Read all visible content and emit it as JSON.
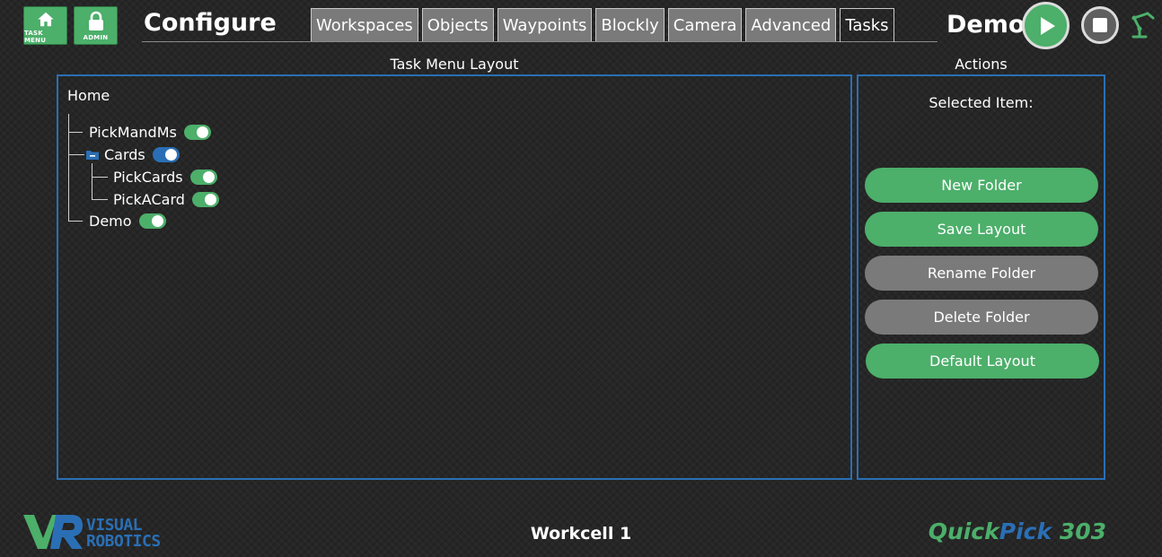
{
  "colors": {
    "accent_green": "#4caf6a",
    "accent_blue": "#2a6fb5",
    "button_gray": "#7a7a7a"
  },
  "header": {
    "task_menu_label": "TASK MENU",
    "admin_label": "ADMIN",
    "title": "Configure",
    "tabs": [
      {
        "label": "Workspaces",
        "active": false
      },
      {
        "label": "Objects",
        "active": false
      },
      {
        "label": "Waypoints",
        "active": false
      },
      {
        "label": "Blockly",
        "active": false
      },
      {
        "label": "Camera",
        "active": false
      },
      {
        "label": "Advanced",
        "active": false
      },
      {
        "label": "Tasks",
        "active": true
      }
    ],
    "mode_title": "Demo",
    "icons": [
      "home-icon",
      "lock-icon",
      "play-icon",
      "stop-icon",
      "robot-arm-icon"
    ]
  },
  "layout_panel": {
    "heading": "Task Menu Layout",
    "root": "Home",
    "tree": [
      {
        "label": "PickMandMs",
        "type": "task",
        "enabled": true
      },
      {
        "label": "Cards",
        "type": "folder",
        "enabled": true,
        "expanded": true,
        "children": [
          {
            "label": "PickCards",
            "type": "task",
            "enabled": true
          },
          {
            "label": "PickACard",
            "type": "task",
            "enabled": true
          }
        ]
      },
      {
        "label": "Demo",
        "type": "task",
        "enabled": true
      }
    ]
  },
  "actions_panel": {
    "heading": "Actions",
    "selected_label": "Selected Item:",
    "buttons": [
      {
        "label": "New Folder",
        "state": "enabled"
      },
      {
        "label": "Save Layout",
        "state": "enabled"
      },
      {
        "label": "Rename Folder",
        "state": "disabled"
      },
      {
        "label": "Delete Folder",
        "state": "disabled"
      },
      {
        "label": "Default Layout",
        "state": "enabled"
      }
    ]
  },
  "footer": {
    "logo_line1": "VISUAL",
    "logo_line2": "ROBOTICS",
    "workcell": "Workcell 1",
    "product_part1": "Quick",
    "product_part2": "Pick",
    "product_part3": " 303"
  }
}
